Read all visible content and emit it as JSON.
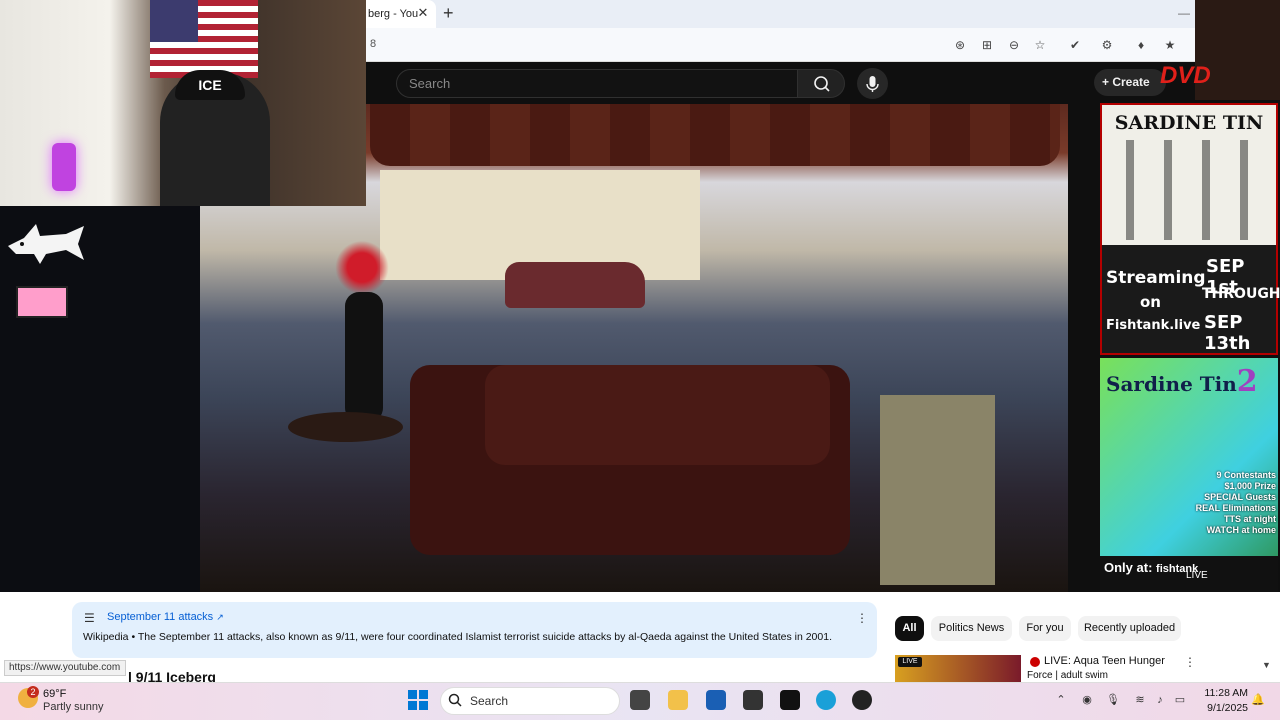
{
  "browser": {
    "tab_title": "berg - You",
    "tab_close": "✕",
    "new_tab": "+",
    "url_text": "8",
    "minimize": "—"
  },
  "youtube": {
    "search_placeholder": "Search",
    "create_label": "Create",
    "wikipedia_card": {
      "title": "September 11 attacks",
      "text_source": "Wikipedia",
      "text": " • The September 11 attacks, also known as 9/11, were four coordinated Islamist terrorist suicide attacks by al-Qaeda against the United States in 2001."
    },
    "video_title": "l 9/11 Iceberg",
    "status_url": "https://www.youtube.com",
    "chips": [
      "All",
      "Politics News",
      "For you",
      "Recently uploaded"
    ],
    "recommendation": {
      "badge": "LIVE",
      "title": "LIVE: Aqua Teen Hunger",
      "subtitle": "Force | adult swim"
    }
  },
  "overlays": {
    "cap_text": "ICE",
    "dvd_text": "DVD",
    "ad1": {
      "title": "SARDINE TIN",
      "line1": "Streaming",
      "line2": "on",
      "line3": "Fishtank.live",
      "dates1": "SEP 1st",
      "dates2": "THROUGH",
      "dates3": "SEP 13th"
    },
    "ad2": {
      "title": "Sardine Tin",
      "number": "2",
      "info1": "9 Contestants",
      "info2": "$1,000 Prize",
      "info3": "SPECIAL Guests",
      "info4": "REAL Eliminations",
      "info5": "TTS at night",
      "info6": "WATCH at home",
      "only_at": "Only at:",
      "brand": "fishtank",
      "live": "LIVE"
    }
  },
  "taskbar": {
    "weather_badge": "2",
    "temperature": "69°F",
    "condition": "Partly sunny",
    "search_label": "Search",
    "time": "11:28 AM",
    "date": "9/1/2025"
  }
}
